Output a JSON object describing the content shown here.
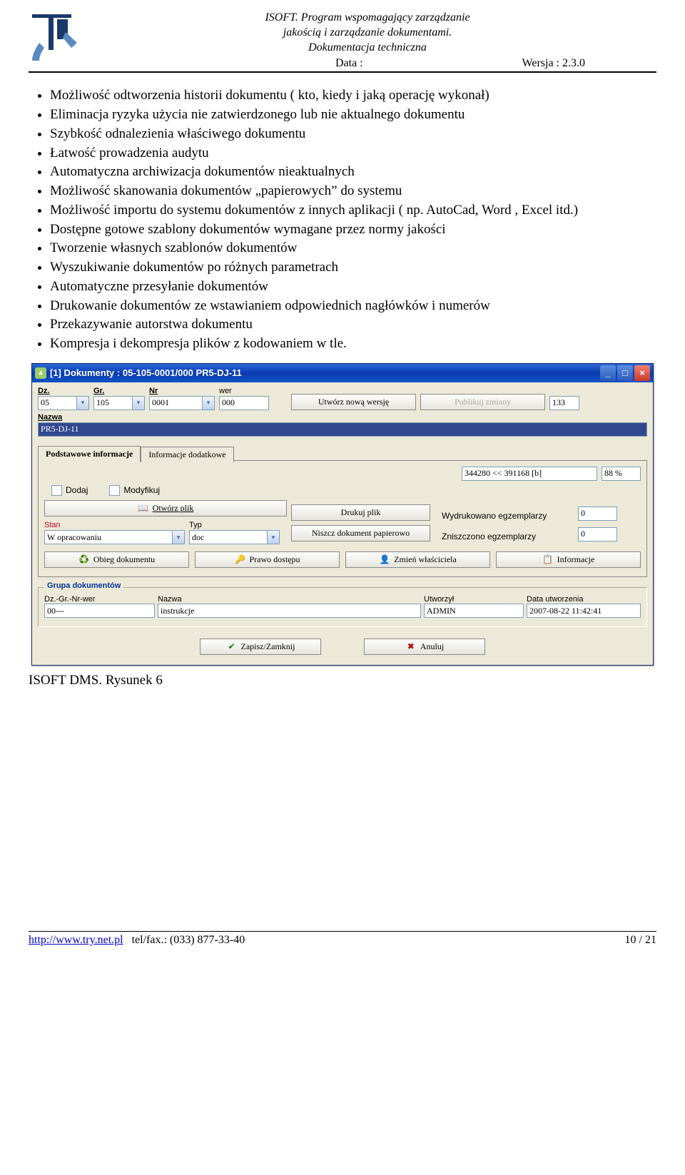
{
  "header": {
    "line1": "ISOFT. Program wspomagający zarządzanie",
    "line2": "jakością i zarządzanie dokumentami.",
    "line3": "Dokumentacja techniczna",
    "meta_left": "Data :",
    "meta_right": "Wersja : 2.3.0"
  },
  "bullets": [
    "Możliwość odtworzenia historii dokumentu ( kto, kiedy i jaką operację wykonał)",
    "Eliminacja ryzyka użycia nie zatwierdzonego lub nie aktualnego dokumentu",
    "Szybkość odnalezienia właściwego dokumentu",
    "Łatwość prowadzenia audytu",
    "Automatyczna archiwizacja dokumentów nieaktualnych",
    "Możliwość skanowania dokumentów „papierowych” do systemu",
    "Możliwość importu do systemu dokumentów z innych aplikacji ( np. AutoCad, Word , Excel itd.)",
    "Dostępne gotowe szablony dokumentów wymagane przez normy jakości",
    "Tworzenie własnych szablonów dokumentów",
    "Wyszukiwanie dokumentów po różnych parametrach",
    "Automatyczne przesyłanie dokumentów",
    "Drukowanie dokumentów ze wstawianiem odpowiednich nagłówków i numerów",
    "Przekazywanie autorstwa dokumentu",
    "Kompresja i dekompresja plików z kodowaniem w tle."
  ],
  "dialog": {
    "title": "[1] Dokumenty : 05-105-0001/000 PR5-DJ-11",
    "fields": {
      "dz_label": "Dz.",
      "dz_value": "05",
      "gr_label": "Gr.",
      "gr_value": "105",
      "nr_label": "Nr",
      "nr_value": "0001",
      "wer_label": "wer",
      "wer_value": "000",
      "btn_new_version": "Utwórz nową wersję",
      "btn_publish": "Publikuj zmiany",
      "counter": "133",
      "nazwa_label": "Nazwa",
      "nazwa_value": "PR5-DJ-11"
    },
    "tabs": {
      "tab1": "Podstawowe informacje",
      "tab2": "Informacje dodatkowe"
    },
    "info": {
      "size_text": "344280 << 391168 [b]",
      "percent": "88 %",
      "dodaj": "Dodaj",
      "modyfikuj": "Modyfikuj",
      "otworz_plik": "Otwórz plik",
      "drukuj_plik": "Drukuj plik",
      "wydrukowano": "Wydrukowano egzemplarzy",
      "wydrukowano_val": "0",
      "stan_label": "Stan",
      "stan_value": "W opracowaniu",
      "typ_label": "Typ",
      "typ_value": "doc",
      "niszcz": "Niszcz dokument papierowo",
      "zniszczono": "Zniszczono egzemplarzy",
      "zniszczono_val": "0",
      "btn_obieg": "Obieg dokumentu",
      "btn_prawo": "Prawo dostępu",
      "btn_zmien": "Zmień właściciela",
      "btn_info": "Informacje"
    },
    "group": {
      "title": "Grupa dokumentów",
      "c1_label": "Dz.-Gr.-Nr-wer",
      "c1_value": "00---",
      "c2_label": "Nazwa",
      "c2_value": "instrukcje",
      "c3_label": "Utworzył",
      "c3_value": "ADMIN",
      "c4_label": "Data utworzenia",
      "c4_value": "2007-08-22 11:42:41"
    },
    "actions": {
      "save": "Zapisz/Zamknij",
      "cancel": "Anuluj"
    }
  },
  "caption": "ISOFT DMS. Rysunek 6",
  "footer": {
    "url": "http://www.try.net.pl",
    "tel": "tel/fax.: (033) 877-33-40",
    "page": "10 / 21"
  }
}
